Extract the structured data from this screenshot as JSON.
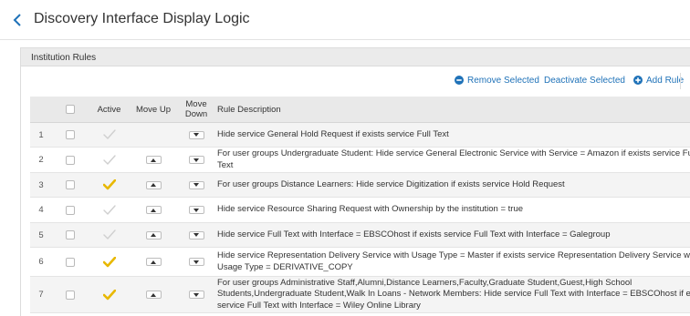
{
  "page": {
    "title": "Discovery Interface Display Logic"
  },
  "panel": {
    "title": "Institution Rules"
  },
  "toolbar": {
    "remove_label": "Remove Selected",
    "deactivate_label": "Deactivate Selected",
    "add_label": "Add Rule"
  },
  "table": {
    "headers": {
      "active": "Active",
      "move_up": "Move Up",
      "move_down": "Move Down",
      "description": "Rule Description"
    },
    "rows": [
      {
        "num": "1",
        "active": false,
        "description": "Hide service General Hold Request if exists service Full Text"
      },
      {
        "num": "2",
        "active": false,
        "description": "For user groups Undergraduate Student: Hide service General Electronic Service with Service = Amazon if exists service Full Text"
      },
      {
        "num": "3",
        "active": true,
        "description": "For user groups Distance Learners: Hide service Digitization if exists service Hold Request"
      },
      {
        "num": "4",
        "active": false,
        "description": "Hide service Resource Sharing Request with Ownership by the institution = true"
      },
      {
        "num": "5",
        "active": false,
        "description": "Hide service Full Text with Interface = EBSCOhost if exists service Full Text with Interface = Galegroup"
      },
      {
        "num": "6",
        "active": true,
        "description": "Hide service Representation Delivery Service with Usage Type = Master if exists service Representation Delivery Service with Usage Type = DERIVATIVE_COPY"
      },
      {
        "num": "7",
        "active": true,
        "description": "For user groups Administrative Staff,Alumni,Distance Learners,Faculty,Graduate Student,Guest,High School Students,Undergraduate Student,Walk In Loans - Network Members: Hide service Full Text with Interface = EBSCOhost if exists service Full Text with Interface = Wiley Online Library"
      }
    ]
  },
  "colors": {
    "link": "#1f72b8",
    "active_check": "#e8b800",
    "inactive_check": "#cfcfcf",
    "header_bg": "#e9e9e9"
  }
}
